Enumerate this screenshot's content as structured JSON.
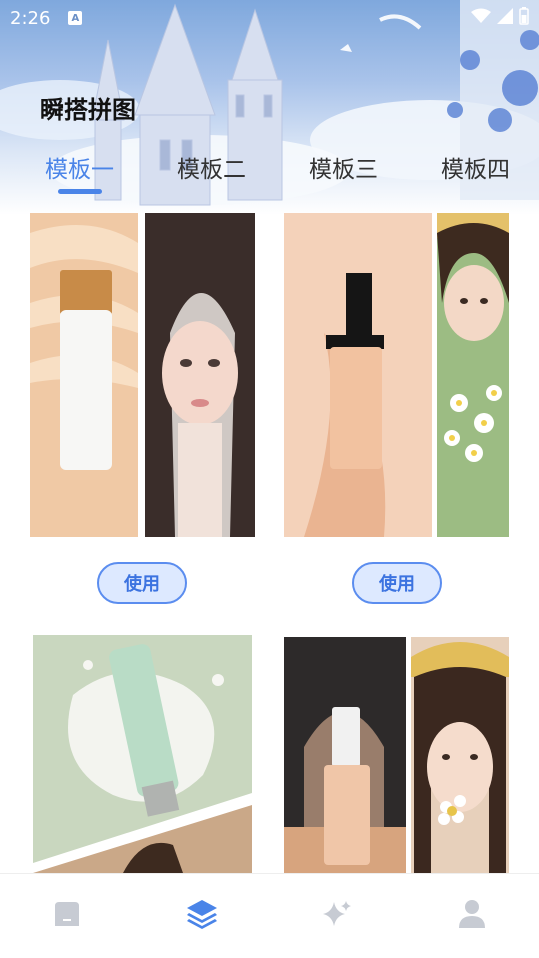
{
  "status_bar": {
    "time": "2:26",
    "notification_icon": "A"
  },
  "header": {
    "title": "瞬搭拼图"
  },
  "tabs": [
    {
      "label": "模板一",
      "active": true
    },
    {
      "label": "模板二",
      "active": false
    },
    {
      "label": "模板三",
      "active": false
    },
    {
      "label": "模板四",
      "active": false
    }
  ],
  "templates": [
    {
      "use_label": "使用"
    },
    {
      "use_label": "使用"
    }
  ],
  "bottom_nav": [
    {
      "icon": "home-icon",
      "active": false
    },
    {
      "icon": "layers-icon",
      "active": true
    },
    {
      "icon": "sparkle-icon",
      "active": false
    },
    {
      "icon": "profile-icon",
      "active": false
    }
  ],
  "colors": {
    "accent": "#4a84e8",
    "inactive_icon": "#c7cbd3",
    "button_bg": "#dde9ff"
  }
}
